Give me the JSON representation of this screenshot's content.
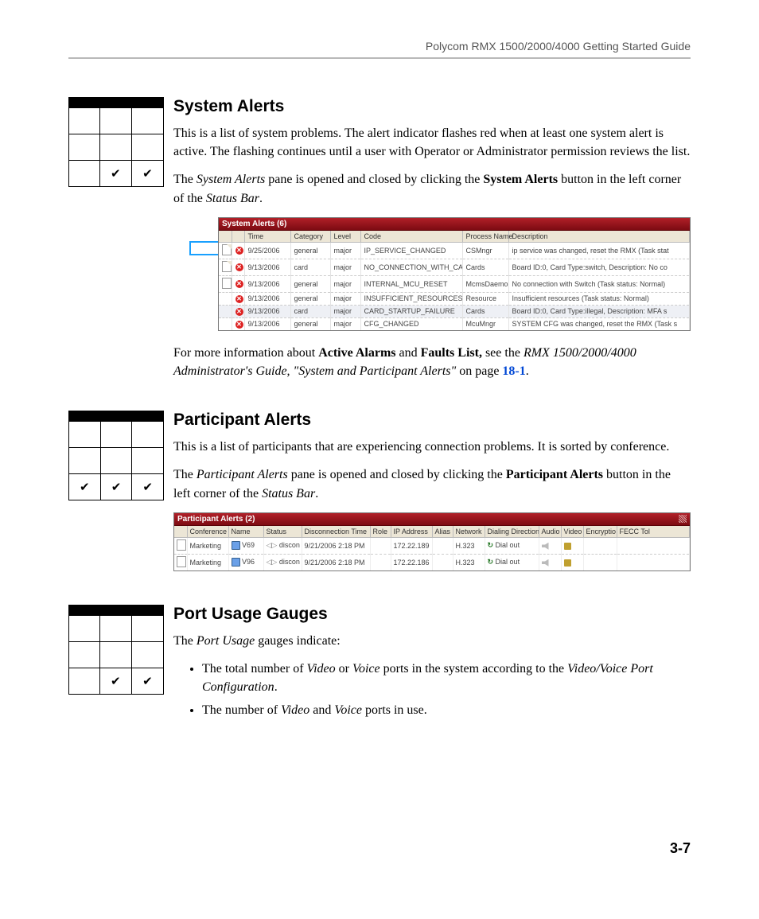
{
  "header": {
    "title": "Polycom RMX 1500/2000/4000 Getting Started Guide"
  },
  "page_number": "3-7",
  "checks": {
    "system_alerts": [
      "",
      "✔",
      "✔"
    ],
    "participant_alerts": [
      "✔",
      "✔",
      "✔"
    ],
    "port_usage": [
      "",
      "✔",
      "✔"
    ]
  },
  "sections": {
    "system_alerts": {
      "heading": "System Alerts",
      "p1": "This is a list of system problems. The alert indicator flashes red when at least one system alert is active. The flashing continues until a user with Operator or Administrator permission reviews the list.",
      "p2_a": "The ",
      "p2_em": "System Alerts",
      "p2_b": " pane is opened and closed by clicking the ",
      "p2_bold": "System Alerts",
      "p2_c": " button in the left corner of the ",
      "p2_em2": "Status Bar",
      "p2_d": ".",
      "p3_a": "For more information about ",
      "p3_b1": "Active Alarms",
      "p3_b": " and ",
      "p3_b2": "Faults List,",
      "p3_c": " see the ",
      "p3_em": "RMX 1500/2000/4000 Administrator's Guide, \"System and Participant Alerts\"",
      "p3_d": " on page ",
      "p3_link": "18-1",
      "p3_e": "."
    },
    "participant_alerts": {
      "heading": "Participant Alerts",
      "p1": "This is a list of participants that are experiencing connection problems. It is sorted by conference.",
      "p2_a": "The ",
      "p2_em": "Participant Alerts",
      "p2_b": " pane is opened and closed by clicking the ",
      "p2_bold": "Participant Alerts",
      "p2_c": " button in the left corner of the ",
      "p2_em2": "Status Bar",
      "p2_d": "."
    },
    "port_usage": {
      "heading": "Port Usage Gauges",
      "p1_a": "The ",
      "p1_em": "Port Usage",
      "p1_b": " gauges indicate:",
      "b1_a": "The total number of ",
      "b1_em1": "Video",
      "b1_b": " or ",
      "b1_em2": "Voice",
      "b1_c": " ports in the system according to the ",
      "b1_em3": "Video/Voice Port Configuration",
      "b1_d": ".",
      "b2_a": "The number of ",
      "b2_em1": "Video",
      "b2_b": " and ",
      "b2_em2": "Voice",
      "b2_c": " ports in use."
    }
  },
  "system_alerts_figure": {
    "title": "System Alerts (6)",
    "columns": [
      "",
      "",
      "Time",
      "Category",
      "Level",
      "Code",
      "Process Name",
      "Description"
    ],
    "rows": [
      {
        "tab": "A",
        "time": "9/25/2006",
        "category": "general",
        "level": "major",
        "code": "IP_SERVICE_CHANGED",
        "process": "CSMngr",
        "desc": "ip service was changed, reset the RMX (Task stat"
      },
      {
        "tab": "A",
        "time": "9/13/2006",
        "category": "card",
        "level": "major",
        "code": "NO_CONNECTION_WITH_CARD",
        "process": "Cards",
        "desc": "Board ID:0, Card Type:switch, Description: No co"
      },
      {
        "tab": "B",
        "time": "9/13/2006",
        "category": "general",
        "level": "major",
        "code": "INTERNAL_MCU_RESET",
        "process": "McmsDaemo",
        "desc": "No connection with Switch (Task status: Normal)"
      },
      {
        "tab": "",
        "time": "9/13/2006",
        "category": "general",
        "level": "major",
        "code": "INSUFFICIENT_RESOURCES",
        "process": "Resource",
        "desc": "Insufficient resources (Task status: Normal)"
      },
      {
        "tab": "",
        "time": "9/13/2006",
        "category": "card",
        "level": "major",
        "code": "CARD_STARTUP_FAILURE",
        "process": "Cards",
        "desc": "Board ID:0, Card Type:illegal, Description: MFA s",
        "sel": true
      },
      {
        "tab": "",
        "time": "9/13/2006",
        "category": "general",
        "level": "major",
        "code": "CFG_CHANGED",
        "process": "McuMngr",
        "desc": "SYSTEM CFG was changed, reset the RMX (Task s"
      }
    ]
  },
  "participant_alerts_figure": {
    "title": "Participant Alerts (2)",
    "columns": [
      "",
      "Conference",
      "Name",
      "Status",
      "Disconnection Time",
      "Role",
      "IP Address",
      "Alias",
      "Network",
      "Dialing Direction",
      "Audio",
      "Video",
      "Encryptio",
      "FECC Tol"
    ],
    "rows": [
      {
        "conf": "Marketing",
        "name": "V69",
        "status": "discon",
        "time": "9/21/2006 2:18 PM",
        "role": "",
        "ip": "172.22.189",
        "alias": "",
        "net": "H.323",
        "dir": "Dial out"
      },
      {
        "conf": "Marketing",
        "name": "V96",
        "status": "discon",
        "time": "9/21/2006 2:18 PM",
        "role": "",
        "ip": "172.22.186",
        "alias": "",
        "net": "H.323",
        "dir": "Dial out"
      }
    ]
  }
}
